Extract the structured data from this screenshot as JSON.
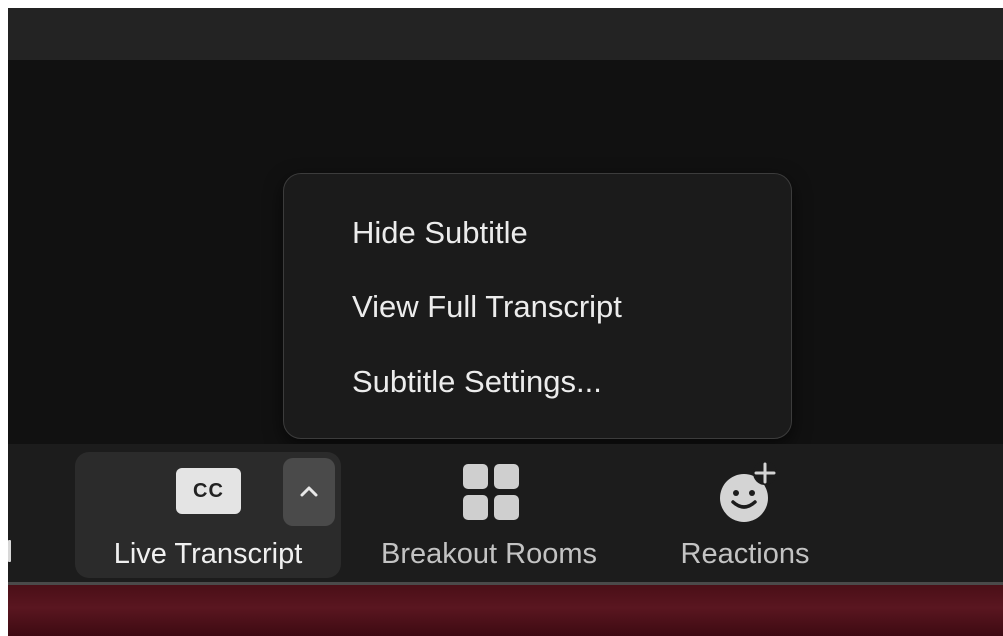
{
  "menu": {
    "items": [
      {
        "label": "Hide Subtitle"
      },
      {
        "label": "View Full Transcript"
      },
      {
        "label": "Subtitle Settings..."
      }
    ]
  },
  "toolbar": {
    "live_transcript": {
      "label": "Live Transcript",
      "icon_text": "CC",
      "icon": "closed-captions-icon",
      "caret_icon": "chevron-up-icon"
    },
    "breakout_rooms": {
      "label": "Breakout Rooms",
      "icon": "grid-icon"
    },
    "reactions": {
      "label": "Reactions",
      "icon": "smiley-plus-icon"
    }
  },
  "colors": {
    "toolbar_bg": "#1c1c1c",
    "menu_bg": "#1b1b1b",
    "active_button_bg": "#2b2b2b",
    "bottom_strip": "#5a1620"
  }
}
